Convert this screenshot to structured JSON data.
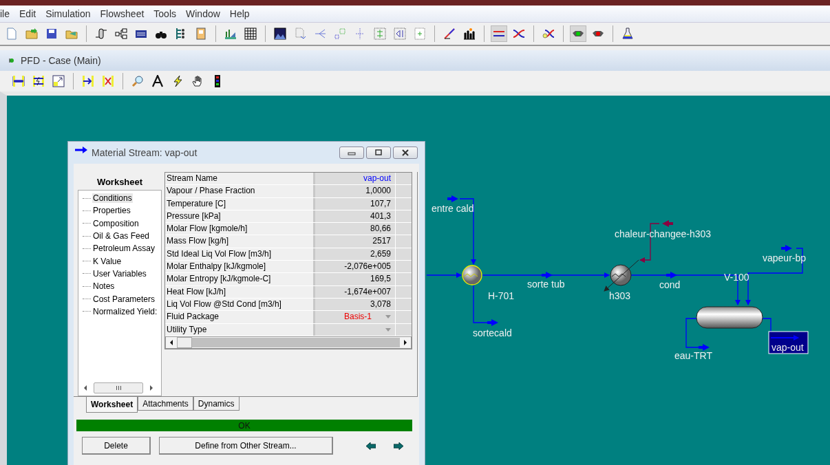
{
  "menu": [
    "ile",
    "Edit",
    "Simulation",
    "Flowsheet",
    "Tools",
    "Window",
    "Help"
  ],
  "pfd_window": {
    "title": "PFD - Case (Main)"
  },
  "diagram": {
    "labels": [
      "entre cald",
      "H-701",
      "sortecald",
      "sorte tub",
      "chaleur-changee-h303",
      "h303",
      "cond",
      "vapeur-bp",
      "V-100",
      "eau-TRT"
    ],
    "selected_stream": {
      "label": "vap-out",
      "selected": true
    }
  },
  "dialog": {
    "title": "Material Stream: vap-out",
    "tree_title": "Worksheet",
    "tree": [
      {
        "label": "Conditions",
        "selected": true
      },
      {
        "label": "Properties",
        "selected": false
      },
      {
        "label": "Composition",
        "selected": false
      },
      {
        "label": "Oil & Gas Feed",
        "selected": false
      },
      {
        "label": "Petroleum Assay",
        "selected": false
      },
      {
        "label": "K Value",
        "selected": false
      },
      {
        "label": "User Variables",
        "selected": false
      },
      {
        "label": "Notes",
        "selected": false
      },
      {
        "label": "Cost Parameters",
        "selected": false
      },
      {
        "label": "Normalized Yield:",
        "selected": false
      }
    ],
    "rows": [
      {
        "label": "Stream Name",
        "value": "vap-out",
        "kind": "name"
      },
      {
        "label": "Vapour / Phase Fraction",
        "value": "1,0000",
        "kind": "number"
      },
      {
        "label": "Temperature [C]",
        "value": "107,7",
        "kind": "number"
      },
      {
        "label": "Pressure [kPa]",
        "value": "401,3",
        "kind": "number"
      },
      {
        "label": "Molar Flow [kgmole/h]",
        "value": "80,66",
        "kind": "number"
      },
      {
        "label": "Mass Flow [kg/h]",
        "value": "2517",
        "kind": "number"
      },
      {
        "label": "Std Ideal Liq Vol Flow [m3/h]",
        "value": "2,659",
        "kind": "number"
      },
      {
        "label": "Molar Enthalpy [kJ/kgmole]",
        "value": "-2,076e+005",
        "kind": "number"
      },
      {
        "label": "Molar Entropy [kJ/kgmole-C]",
        "value": "169,5",
        "kind": "number"
      },
      {
        "label": "Heat Flow [kJ/h]",
        "value": "-1,674e+007",
        "kind": "number"
      },
      {
        "label": "Liq Vol Flow @Std Cond [m3/h]",
        "value": "3,078",
        "kind": "number"
      },
      {
        "label": "Fluid Package",
        "value": "Basis-1",
        "kind": "dropdown"
      },
      {
        "label": "Utility Type",
        "kind": "dropdown"
      }
    ],
    "tabs": [
      {
        "label": "Worksheet",
        "selected": true
      },
      {
        "label": "Attachments",
        "selected": false
      },
      {
        "label": "Dynamics",
        "selected": false
      }
    ],
    "status": "OK",
    "buttons": [
      "Delete",
      "Define from Other Stream..."
    ]
  }
}
